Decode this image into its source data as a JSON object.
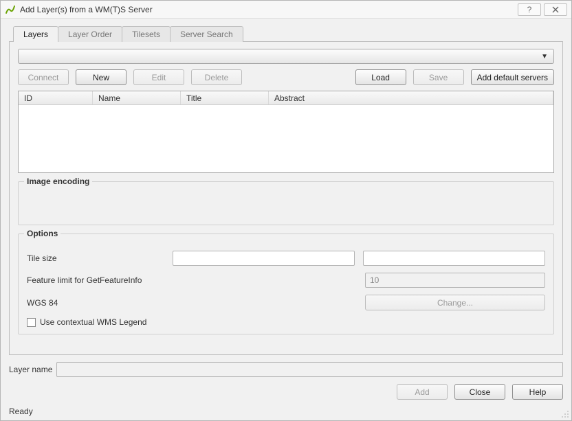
{
  "window": {
    "title": "Add Layer(s) from a WM(T)S Server"
  },
  "tabs": {
    "layers": "Layers",
    "layer_order": "Layer Order",
    "tilesets": "Tilesets",
    "server_search": "Server Search"
  },
  "buttons": {
    "connect": "Connect",
    "new": "New",
    "edit": "Edit",
    "delete": "Delete",
    "load": "Load",
    "save": "Save",
    "add_default_servers": "Add default servers",
    "change": "Change...",
    "add": "Add",
    "close": "Close",
    "help": "Help"
  },
  "columns": {
    "id": "ID",
    "name": "Name",
    "title": "Title",
    "abstract": "Abstract"
  },
  "groups": {
    "image_encoding": "Image encoding",
    "options": "Options"
  },
  "options": {
    "tile_size_label": "Tile size",
    "tile_size_value1": "",
    "tile_size_value2": "",
    "feature_limit_label": "Feature limit for GetFeatureInfo",
    "feature_limit_value": "10",
    "crs_label": "WGS 84",
    "contextual_legend_label": "Use contextual WMS Legend",
    "contextual_legend_checked": false
  },
  "footer": {
    "layer_name_label": "Layer name",
    "layer_name_value": ""
  },
  "status": "Ready"
}
